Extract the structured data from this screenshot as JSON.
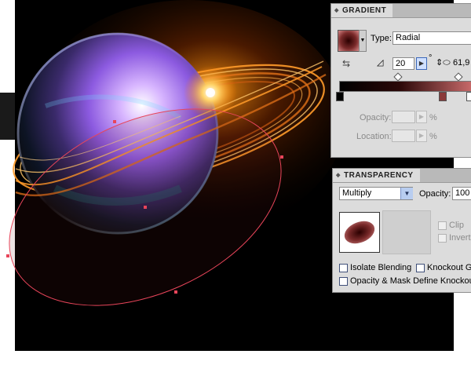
{
  "gradient_panel": {
    "title": "GRADIENT",
    "type_label": "Type:",
    "type_value": "Radial",
    "angle_value": "20",
    "angle_unit": "°",
    "location_value": "61,9",
    "opacity_label": "Opacity:",
    "location_label": "Location:",
    "percent_1": "%",
    "percent_2": "%"
  },
  "transparency_panel": {
    "title": "TRANSPARENCY",
    "blend_mode": "Multiply",
    "opacity_label": "Opacity:",
    "opacity_value": "100",
    "clip_label": "Clip",
    "invert_label": "Invert",
    "isolate_label": "Isolate Blending",
    "knockout_label": "Knockout Gr",
    "define_knockout_label": "Opacity & Mask Define Knockout S"
  },
  "colors": {
    "gradient_start": "#000000",
    "gradient_end": "#c86a6a",
    "path_selection": "#e8455a"
  }
}
